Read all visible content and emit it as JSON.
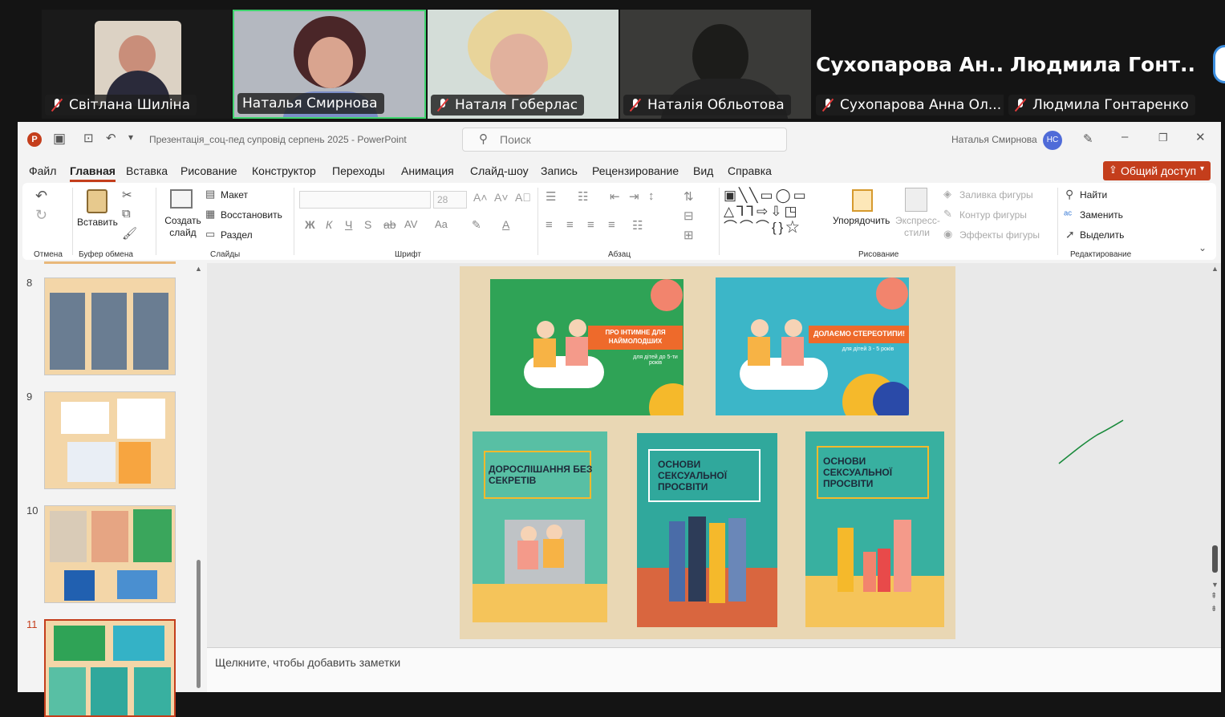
{
  "participants": [
    {
      "name": "Світлана Шиліна"
    },
    {
      "name": "Наталья Смирнова"
    },
    {
      "name": "Наталя Гоберлас"
    },
    {
      "name": "Наталія Обльотова"
    },
    {
      "name": "Сухопарова Анна Ол...",
      "big": "Сухопарова  Ан..."
    },
    {
      "name": "Людмила Гонтаренко",
      "big": "Людмила  Гонт..."
    }
  ],
  "window": {
    "title": "Презентація_соц-пед супровід серпень 2025  -  PowerPoint",
    "search_placeholder": "Поиск",
    "user_name": "Наталья Смирнова",
    "user_initials": "НС"
  },
  "menu": [
    "Файл",
    "Главная",
    "Вставка",
    "Рисование",
    "Конструктор",
    "Переходы",
    "Анимация",
    "Слайд-шоу",
    "Запись",
    "Рецензирование",
    "Вид",
    "Справка"
  ],
  "share_label": "Общий доступ",
  "ribbon": {
    "undo_group": "Отмена",
    "paste": "Вставить",
    "clipboard_group": "Буфер обмена",
    "new_slide": "Создать слайд",
    "layout": "Макет",
    "reset": "Восстановить",
    "section": "Раздел",
    "slides_group": "Слайды",
    "font_size": "28",
    "font_group": "Шрифт",
    "paragraph_group": "Абзац",
    "arrange": "Упорядочить",
    "quick_styles": "Экспресс-стили",
    "shape_fill": "Заливка фигуры",
    "shape_outline": "Контур фигуры",
    "shape_effects": "Эффекты фигуры",
    "drawing_group": "Рисование",
    "find": "Найти",
    "replace": "Заменить",
    "select": "Выделить",
    "editing_group": "Редактирование"
  },
  "thumbnails": [
    "8",
    "9",
    "10",
    "11"
  ],
  "slide": {
    "covers": [
      {
        "title": "ПРО ІНТИМНЕ ДЛЯ НАЙМОЛОДШИХ",
        "subtitle": "для дітей до 5-ти років"
      },
      {
        "title": "ДОЛАЄМО СТЕРЕОТИПИ!",
        "subtitle": "для дітей 3 - 5 років"
      },
      {
        "title": "ДОРОСЛІШАННЯ БЕЗ СЕКРЕТІВ"
      },
      {
        "title": "ОСНОВИ СЕКСУАЛЬНОЇ ПРОСВІТИ"
      },
      {
        "title": "ОСНОВИ СЕКСУАЛЬНОЇ ПРОСВІТИ"
      }
    ]
  },
  "notes_placeholder": "Щелкните, чтобы добавить заметки",
  "colors": {
    "accent": "#c43e1c",
    "speaker_border": "#3fd46e"
  }
}
